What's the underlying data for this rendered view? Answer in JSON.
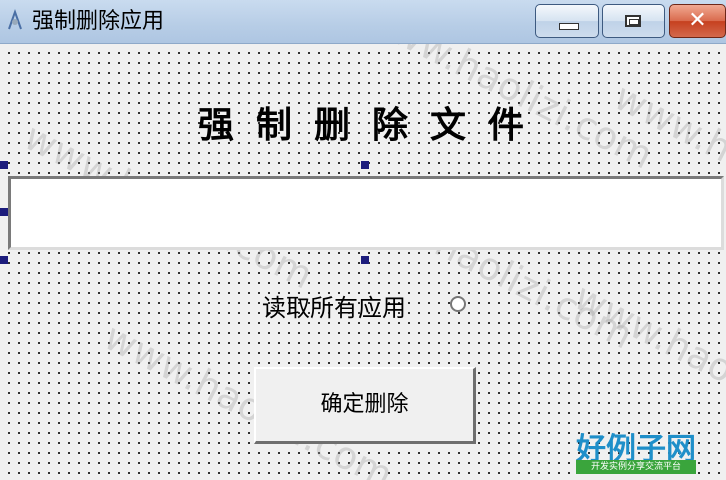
{
  "window": {
    "title": "强制删除应用",
    "icon": "app-icon",
    "controls": {
      "minimize": "minimize-icon",
      "maximize": "maximize-icon",
      "close": "close-icon",
      "close_glyph": "✕"
    }
  },
  "form": {
    "heading": "强制删除文件",
    "path_input": {
      "value": "",
      "placeholder": ""
    },
    "radio": {
      "label": "读取所有应用",
      "checked": false
    },
    "delete_button": "确定删除"
  },
  "watermark": {
    "text": "www.haolizi.com",
    "logo_main": "好例子网",
    "logo_sub": "开发实例分享交流平台"
  },
  "colors": {
    "titlebar": "#b7cde6",
    "close": "#c6401f",
    "handle": "#1c1c7c",
    "logo_blue": "#1f8fc9",
    "logo_green": "#3aa53c"
  }
}
